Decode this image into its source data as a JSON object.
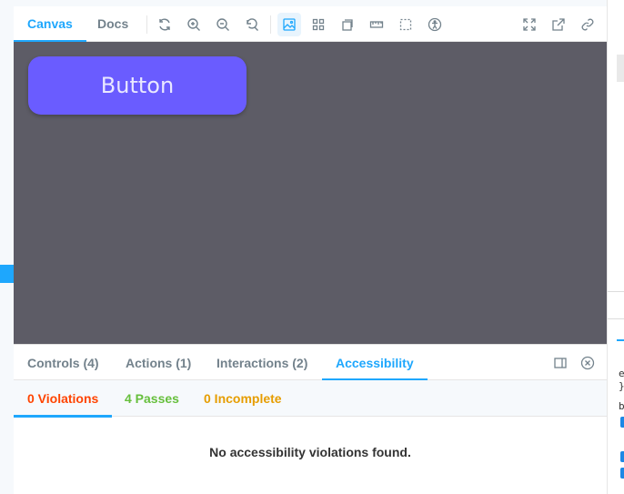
{
  "toolbar": {
    "tabs": [
      {
        "label": "Canvas",
        "active": true
      },
      {
        "label": "Docs",
        "active": false
      }
    ],
    "icons": [
      "reload-icon",
      "zoom-in-icon",
      "zoom-out-icon",
      "reset-zoom-icon",
      "background-icon",
      "grid-icon",
      "outline-icon",
      "measure-icon",
      "viewport-icon",
      "accessibility-icon",
      "fullscreen-icon",
      "open-new-tab-icon",
      "copy-link-icon"
    ]
  },
  "canvas": {
    "button_label": "Button"
  },
  "addons": {
    "tabs": [
      {
        "label": "Controls (4)"
      },
      {
        "label": "Actions (1)"
      },
      {
        "label": "Interactions (2)"
      },
      {
        "label": "Accessibility"
      }
    ]
  },
  "accessibility": {
    "tabs": [
      {
        "label": "0 Violations",
        "color": "#ff4400"
      },
      {
        "label": "4 Passes",
        "color": "#66bf3c"
      },
      {
        "label": "0 Incomplete",
        "color": "#e69d00"
      }
    ],
    "message": "No accessibility violations found."
  },
  "side": {
    "letter_e": "e",
    "letter_brace": "}",
    "letter_b": "b"
  },
  "colors": {
    "accent": "#1ea7fd",
    "canvas_bg": "#5d5c66",
    "button_bg": "#6a5cff"
  }
}
